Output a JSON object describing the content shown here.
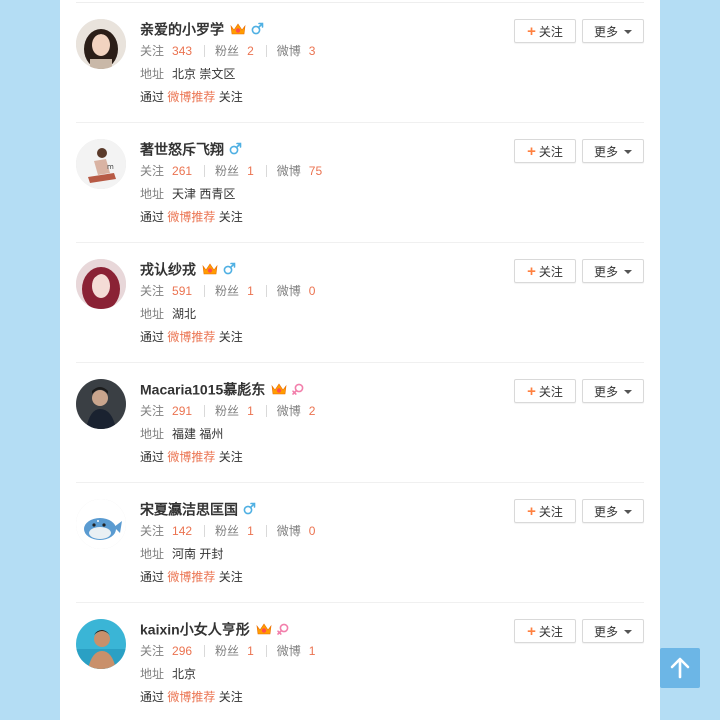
{
  "labels": {
    "following": "关注",
    "fans": "粉丝",
    "weibo": "微博",
    "address": "地址",
    "via_prefix": "通过",
    "via_link": "微博推荐",
    "via_suffix": "关注"
  },
  "buttons": {
    "follow_label": "关注",
    "more_label": "更多"
  },
  "colors": {
    "accent": "#eb7350",
    "male": "#4fb0e3",
    "female": "#f27fab",
    "back_to_top": "#6cb6e6"
  },
  "users": [
    {
      "name": "亲爱的小罗学",
      "vip": true,
      "gender": "male",
      "following": "343",
      "fans": "2",
      "weibo": "3",
      "address": "北京 崇文区",
      "avatar": "girl-dark-hair"
    },
    {
      "name": "著世怒斥飞翔",
      "vip": false,
      "gender": "male",
      "following": "261",
      "fans": "1",
      "weibo": "75",
      "address": "天津 西青区",
      "avatar": "cartoon-sitting"
    },
    {
      "name": "戎认纱戎",
      "vip": true,
      "gender": "male",
      "following": "591",
      "fans": "1",
      "weibo": "0",
      "address": "湖北",
      "avatar": "girl-red-hair"
    },
    {
      "name": "Macaria1015慕彪东",
      "vip": true,
      "gender": "female",
      "following": "291",
      "fans": "1",
      "weibo": "2",
      "address": "福建 福州",
      "avatar": "man-dark"
    },
    {
      "name": "宋夏瀛洁思匡国",
      "vip": false,
      "gender": "male",
      "following": "142",
      "fans": "1",
      "weibo": "0",
      "address": "河南 开封",
      "avatar": "cartoon-whale"
    },
    {
      "name": "kaixin小女人亨彤",
      "vip": true,
      "gender": "female",
      "following": "296",
      "fans": "1",
      "weibo": "1",
      "address": "北京",
      "avatar": "man-swimming"
    }
  ],
  "back_to_top": {
    "icon": "arrow-up-icon"
  }
}
